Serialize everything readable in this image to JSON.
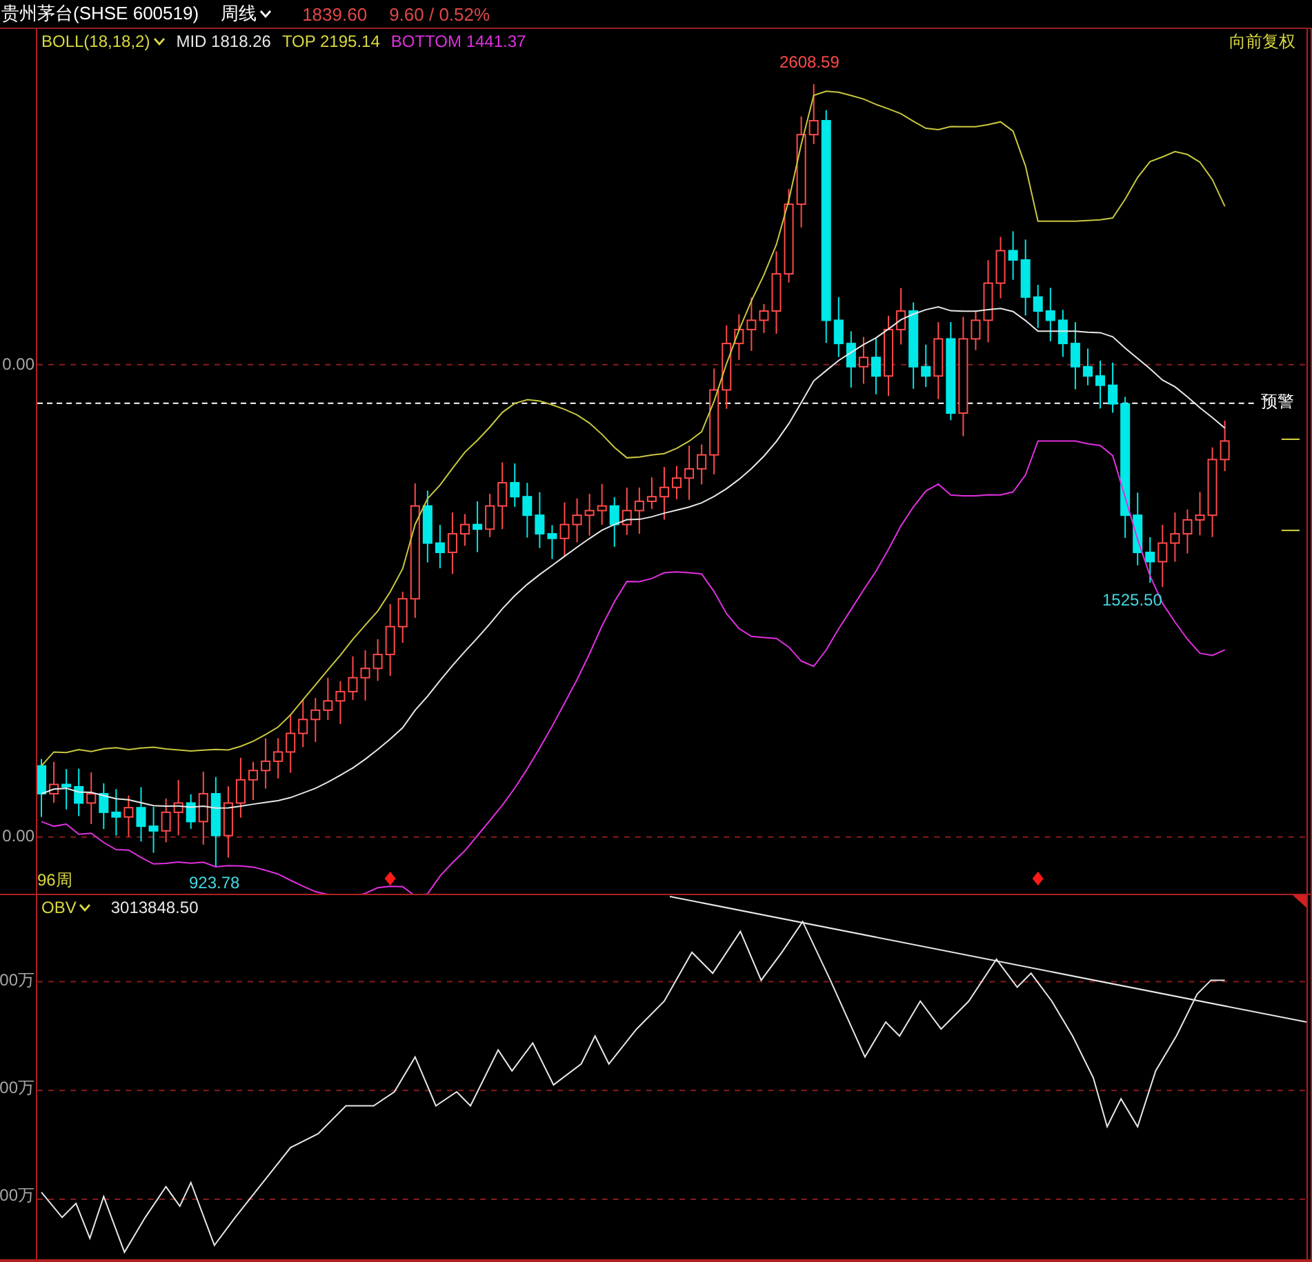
{
  "header": {
    "stock": "贵州茅台(SHSE 600519)",
    "period": "周线",
    "price": "1839.60",
    "change": "9.60 / 0.52%"
  },
  "main_panel": {
    "indicator": "BOLL(18,18,2)",
    "mid": "MID 1818.26",
    "top": "TOP 2195.14",
    "bottom": "BOTTOM 1441.37",
    "adjust": "向前复权",
    "axis_labels": [
      "0.00",
      "0.00"
    ],
    "alert": "预警",
    "high_label": "2608.59",
    "low_label": "923.78",
    "recent_low_label": "1525.50",
    "bar_count": "96周"
  },
  "obv_panel": {
    "indicator": "OBV",
    "value": "3013848.50",
    "axis_labels": [
      "00万",
      "00万",
      "00万"
    ]
  }
}
